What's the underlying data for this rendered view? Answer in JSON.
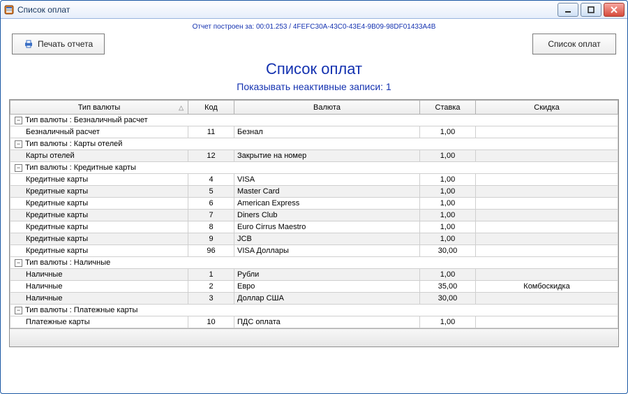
{
  "window": {
    "title": "Список оплат"
  },
  "report_info": {
    "prefix": "Отчет построен за: ",
    "time": "00:01.253",
    "sep": " / ",
    "guid": "4FEFC30A-43C0-43E4-9B09-98DF01433A4B"
  },
  "buttons": {
    "print": "Печать отчета",
    "list": "Список оплат"
  },
  "heading": "Список оплат",
  "subheading": "Показывать неактивные записи: 1",
  "columns": {
    "type": "Тип валюты",
    "code": "Код",
    "currency": "Валюта",
    "rate": "Ставка",
    "discount": "Скидка"
  },
  "group_label_prefix": "Тип валюты : ",
  "groups": [
    {
      "name": "Безналичный расчет",
      "rows": [
        {
          "type": "Безналичный расчет",
          "code": "11",
          "currency": "Безнал",
          "rate": "1,00",
          "discount": ""
        }
      ]
    },
    {
      "name": "Карты отелей",
      "rows": [
        {
          "type": "Карты отелей",
          "code": "12",
          "currency": "Закрытие на номер",
          "rate": "1,00",
          "discount": ""
        }
      ]
    },
    {
      "name": "Кредитные карты",
      "rows": [
        {
          "type": "Кредитные карты",
          "code": "4",
          "currency": "VISA",
          "rate": "1,00",
          "discount": ""
        },
        {
          "type": "Кредитные карты",
          "code": "5",
          "currency": "Master Card",
          "rate": "1,00",
          "discount": ""
        },
        {
          "type": "Кредитные карты",
          "code": "6",
          "currency": "American Express",
          "rate": "1,00",
          "discount": ""
        },
        {
          "type": "Кредитные карты",
          "code": "7",
          "currency": "Diners Club",
          "rate": "1,00",
          "discount": ""
        },
        {
          "type": "Кредитные карты",
          "code": "8",
          "currency": "Euro Cirrus Maestro",
          "rate": "1,00",
          "discount": ""
        },
        {
          "type": "Кредитные карты",
          "code": "9",
          "currency": "JCB",
          "rate": "1,00",
          "discount": ""
        },
        {
          "type": "Кредитные карты",
          "code": "96",
          "currency": "VISA Доллары",
          "rate": "30,00",
          "discount": ""
        }
      ]
    },
    {
      "name": "Наличные",
      "rows": [
        {
          "type": "Наличные",
          "code": "1",
          "currency": "Рубли",
          "rate": "1,00",
          "discount": ""
        },
        {
          "type": "Наличные",
          "code": "2",
          "currency": "Евро",
          "rate": "35,00",
          "discount": "Комбоскидка"
        },
        {
          "type": "Наличные",
          "code": "3",
          "currency": "Доллар США",
          "rate": "30,00",
          "discount": ""
        }
      ]
    },
    {
      "name": "Платежные карты",
      "rows": [
        {
          "type": "Платежные карты",
          "code": "10",
          "currency": "ПДС оплата",
          "rate": "1,00",
          "discount": ""
        }
      ]
    }
  ]
}
